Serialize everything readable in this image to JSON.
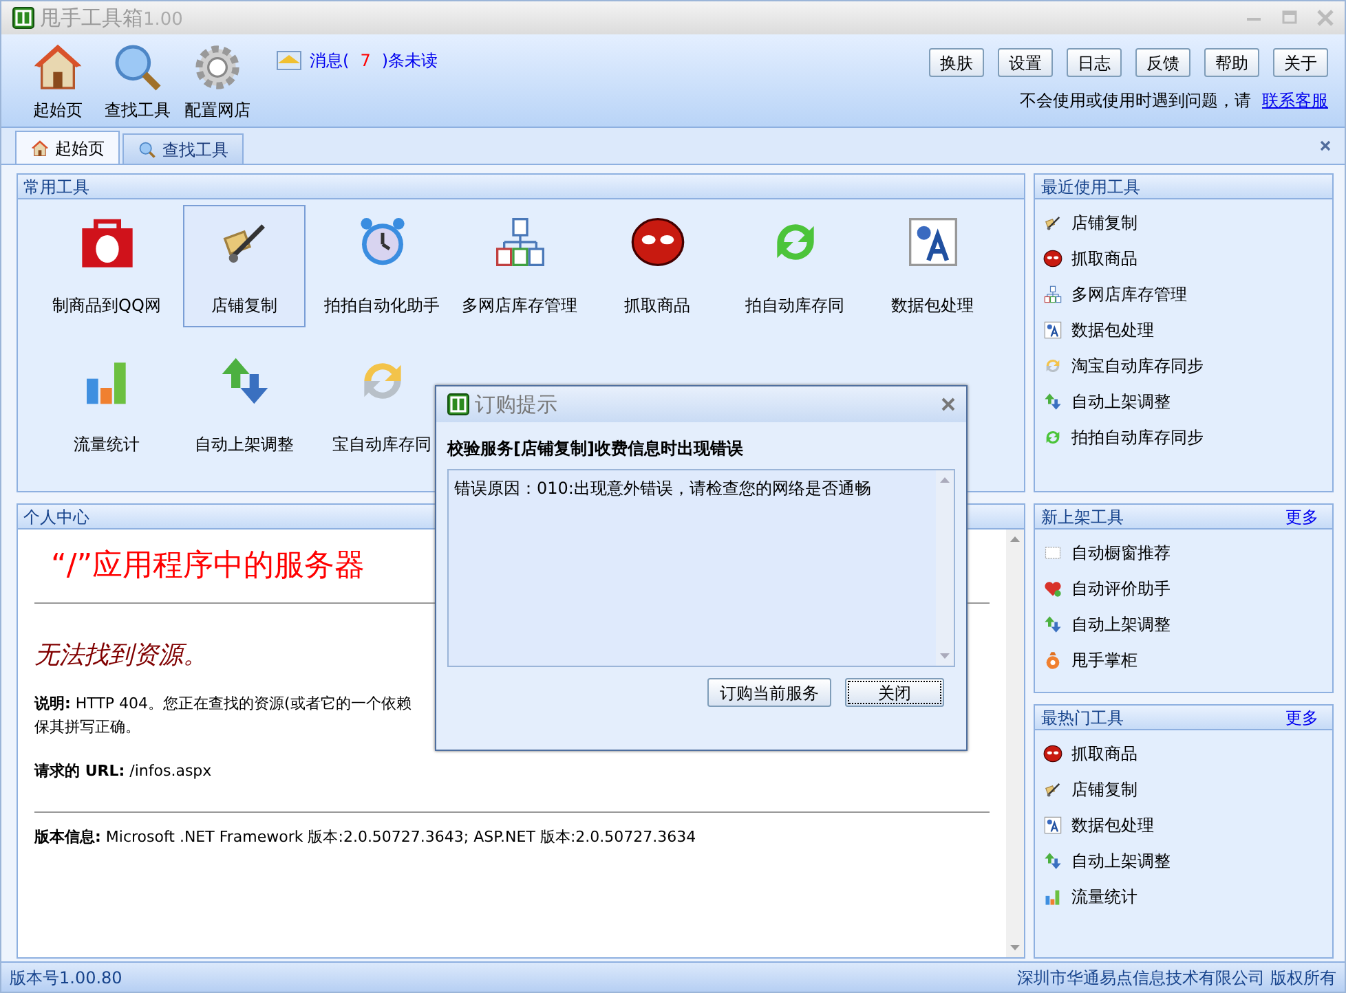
{
  "window": {
    "title": "甩手工具箱",
    "version": "1.00"
  },
  "toolbar": {
    "items": [
      {
        "label": "起始页",
        "kind": "home"
      },
      {
        "label": "查找工具",
        "kind": "search"
      },
      {
        "label": "配置网店",
        "kind": "gear"
      }
    ],
    "message": {
      "prefix": "消息(",
      "count": "7",
      "suffix": ")条未读"
    },
    "buttons": [
      "换肤",
      "设置",
      "日志",
      "反馈",
      "帮助",
      "关于"
    ],
    "help_text": "不会使用或使用时遇到问题，请",
    "help_link": "联系客服"
  },
  "tabs": [
    {
      "label": "起始页",
      "kind": "home",
      "selected": true
    },
    {
      "label": "查找工具",
      "kind": "search",
      "selected": false
    }
  ],
  "common_tools": {
    "title": "常用工具",
    "items": [
      {
        "label": "制商品到QQ网",
        "kind": "bag",
        "selected": false
      },
      {
        "label": "店铺复制",
        "kind": "cart",
        "selected": true
      },
      {
        "label": "拍拍自动化助手",
        "kind": "clock",
        "selected": false
      },
      {
        "label": "多网店库存管理",
        "kind": "network",
        "selected": false
      },
      {
        "label": "抓取商品",
        "kind": "spider",
        "selected": false
      },
      {
        "label": "拍自动库存同",
        "kind": "sync",
        "selected": false
      },
      {
        "label": "数据包处理",
        "kind": "text",
        "selected": false
      },
      {
        "label": "流量统计",
        "kind": "chart",
        "selected": false
      },
      {
        "label": "自动上架调整",
        "kind": "updown",
        "selected": false
      },
      {
        "label": "宝自动库存同",
        "kind": "sync2",
        "selected": false
      }
    ]
  },
  "personal_center": {
    "title": "个人中心",
    "heading": "“/”应用程序中的服务器",
    "subheading": "无法找到资源。",
    "description_label": "说明:",
    "description": "HTTP 404。您正在查找的资源(或者它的一个依赖",
    "description_line2": "保其拼写正确。",
    "url_label": "请求的  URL:",
    "url": "/infos.aspx",
    "version_label": "版本信息:",
    "version": "Microsoft .NET Framework 版本:2.0.50727.3643; ASP.NET 版本:2.0.50727.3634"
  },
  "recent_tools": {
    "title": "最近使用工具",
    "items": [
      {
        "label": "店铺复制",
        "kind": "cart"
      },
      {
        "label": "抓取商品",
        "kind": "spider"
      },
      {
        "label": "多网店库存管理",
        "kind": "network"
      },
      {
        "label": "数据包处理",
        "kind": "text"
      },
      {
        "label": "淘宝自动库存同步",
        "kind": "sync2"
      },
      {
        "label": "自动上架调整",
        "kind": "updown"
      },
      {
        "label": "拍拍自动库存同步",
        "kind": "sync"
      }
    ]
  },
  "new_tools": {
    "title": "新上架工具",
    "more": "更多",
    "items": [
      {
        "label": "自动橱窗推荐",
        "kind": "window"
      },
      {
        "label": "自动评价助手",
        "kind": "heart"
      },
      {
        "label": "自动上架调整",
        "kind": "updown"
      },
      {
        "label": "甩手掌柜",
        "kind": "moneybag"
      }
    ]
  },
  "hot_tools": {
    "title": "最热门工具",
    "more": "更多",
    "items": [
      {
        "label": "抓取商品",
        "kind": "spider"
      },
      {
        "label": "店铺复制",
        "kind": "cart"
      },
      {
        "label": "数据包处理",
        "kind": "text"
      },
      {
        "label": "自动上架调整",
        "kind": "updown"
      },
      {
        "label": "流量统计",
        "kind": "chart"
      }
    ]
  },
  "dialog": {
    "title": "订购提示",
    "heading": "校验服务[店铺复制]收费信息时出现错误",
    "message": "错误原因：010:出现意外错误，请检查您的网络是否通畅",
    "buttons": [
      {
        "label": "订购当前服务",
        "focused": false
      },
      {
        "label": "关闭",
        "focused": true
      }
    ]
  },
  "status_bar": {
    "version": "版本号1.00.80",
    "copyright": "深圳市华通易点信息技术有限公司 版权所有"
  }
}
